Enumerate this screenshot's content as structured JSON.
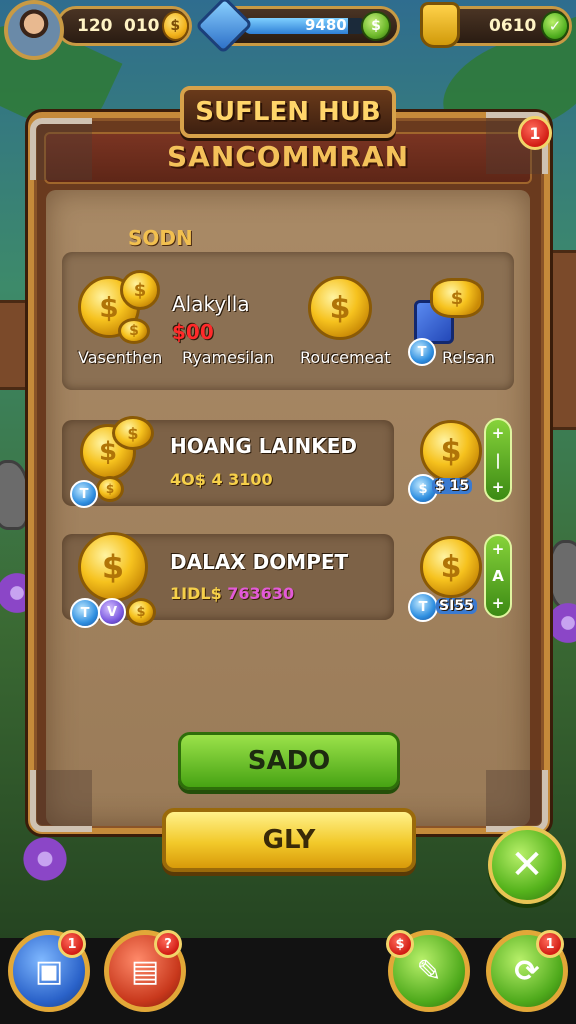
{
  "hud": {
    "left_value": "120",
    "left_value2": "010",
    "middle_value": "9480",
    "middle_progress": 0.85,
    "right_value": "0610"
  },
  "panel": {
    "banner_title": "SUFLEN HUB",
    "subtitle": "SANCOMMRAN",
    "badge_count": "1"
  },
  "section": {
    "title": "SODN",
    "items": [
      {
        "label": "Vasenthen"
      },
      {
        "label": "Ryamesilan"
      },
      {
        "label": "Roucemeat"
      },
      {
        "label": "Relsan"
      }
    ],
    "center_title": "Alakylla",
    "center_value": "$00"
  },
  "rows": [
    {
      "title": "HOANG LAINKED",
      "sub_a": "4O$ 4 3100",
      "sub_b": ""
    },
    {
      "title": "DALAX DOMPET",
      "sub_a": "1IDL$",
      "sub_b": "763630"
    }
  ],
  "side_labels": [
    {
      "text": "$ 15"
    },
    {
      "text": "SI55"
    }
  ],
  "buttons": {
    "primary": "SADO",
    "secondary": "GLY"
  },
  "nav": {
    "badges": [
      "1",
      "?",
      "$",
      "1"
    ]
  },
  "colors": {
    "accent_gold": "#c89a44",
    "button_green": "#47a313",
    "button_yellow": "#f2c92a",
    "badge_red": "#d11c14"
  }
}
